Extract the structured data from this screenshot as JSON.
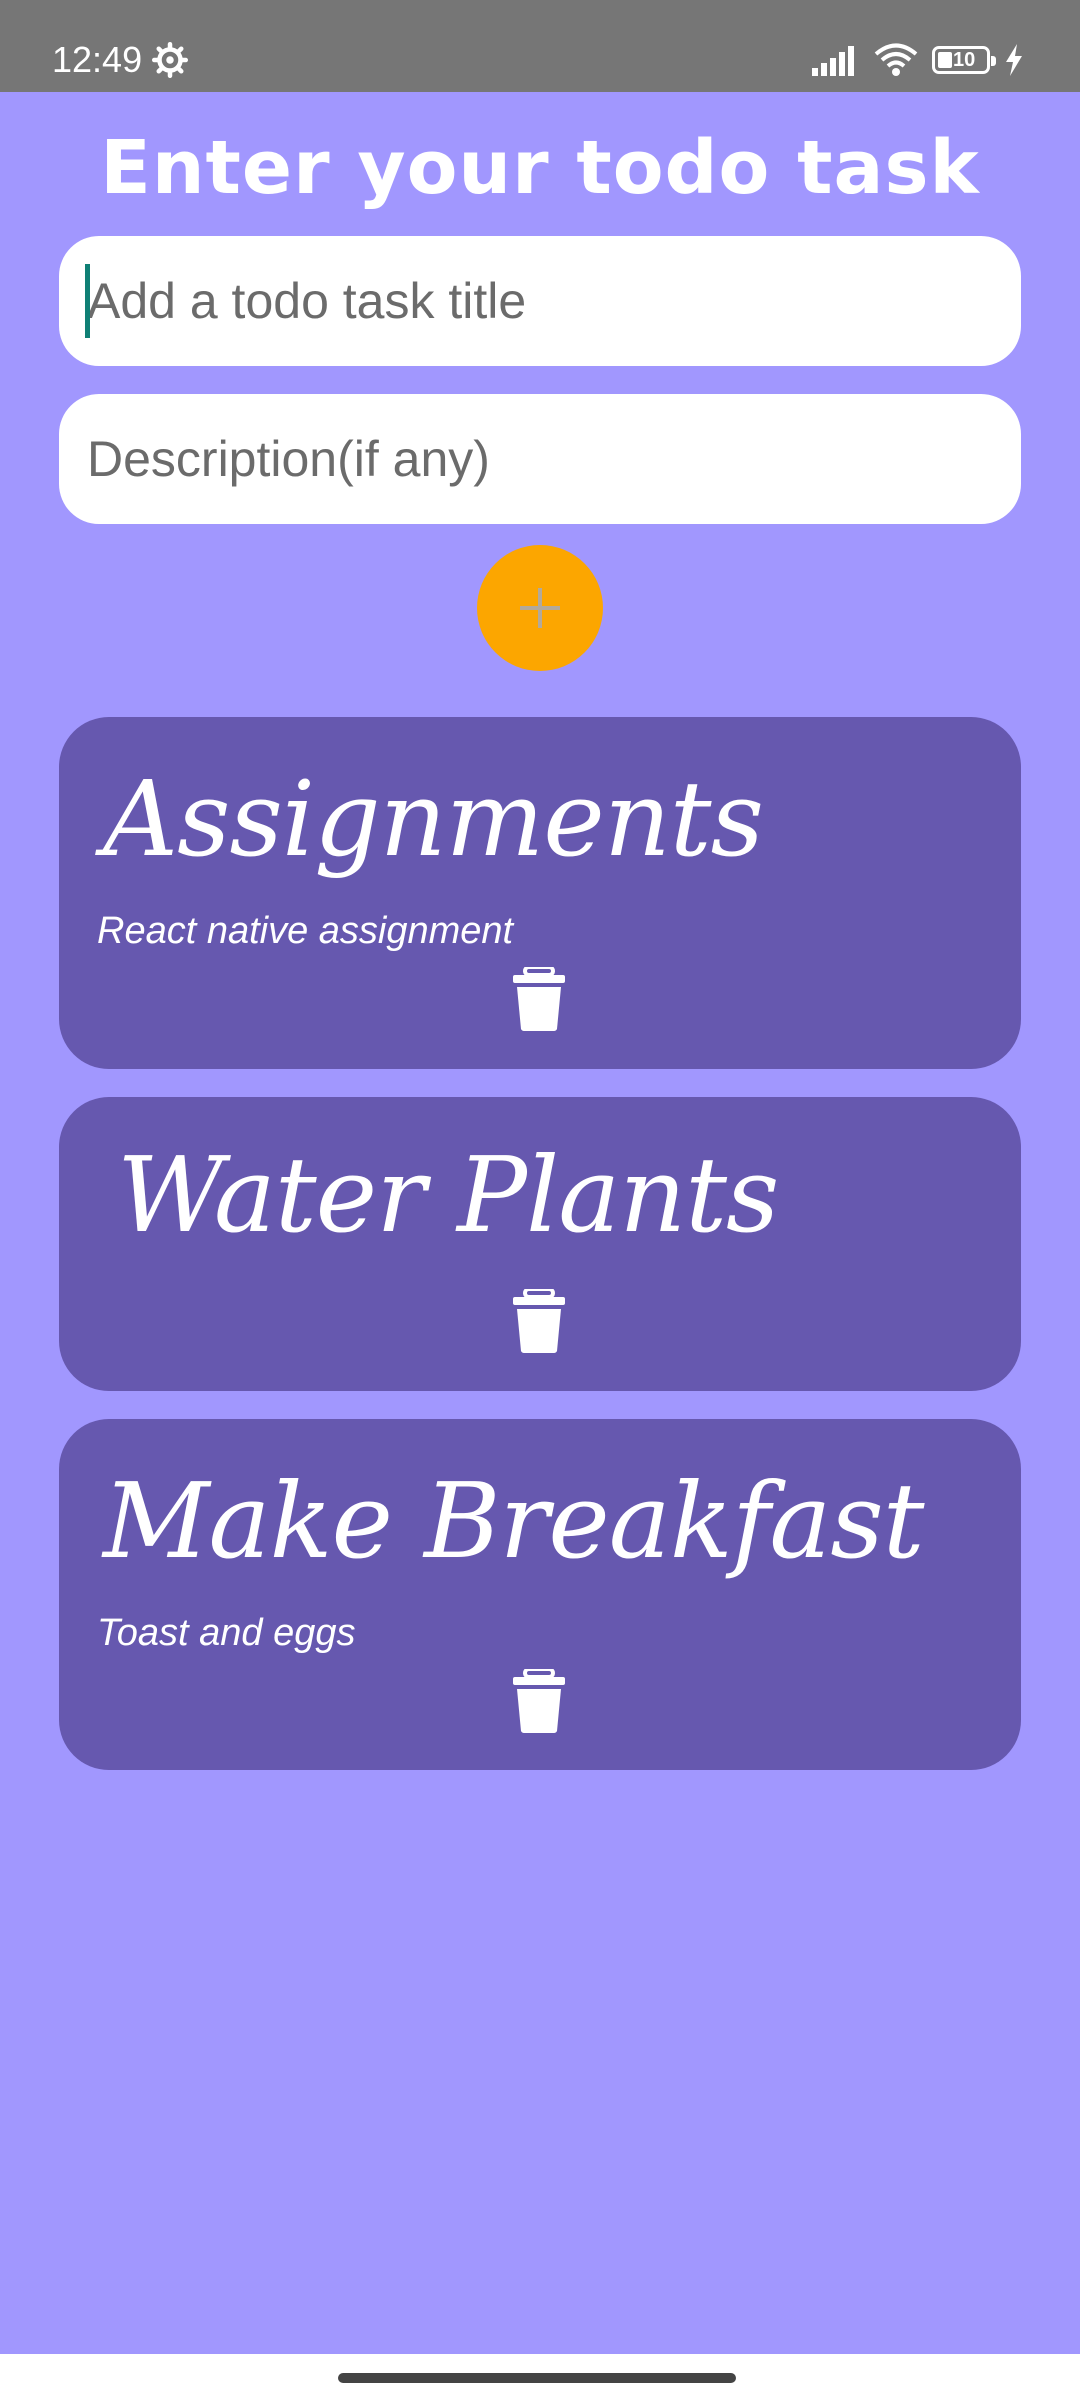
{
  "status_bar": {
    "time": "12:49",
    "battery": "10",
    "icons": [
      "gear-icon",
      "signal-icon",
      "wifi-icon",
      "battery-icon",
      "charging-icon"
    ]
  },
  "header": {
    "title": "Enter your todo task"
  },
  "form": {
    "title_placeholder": "Add a todo task title",
    "description_placeholder": "Description(if any)",
    "add_icon": "plus-icon"
  },
  "todos": [
    {
      "title": "Assignments",
      "description": "React native assignment"
    },
    {
      "title": "Water Plants",
      "description": ""
    },
    {
      "title": "Make Breakfast",
      "description": "Toast and eggs"
    }
  ],
  "colors": {
    "background": "#a197fe",
    "card": "#6658af",
    "accent": "#fca600",
    "status_bar": "#767676",
    "caret": "#0f8075"
  }
}
